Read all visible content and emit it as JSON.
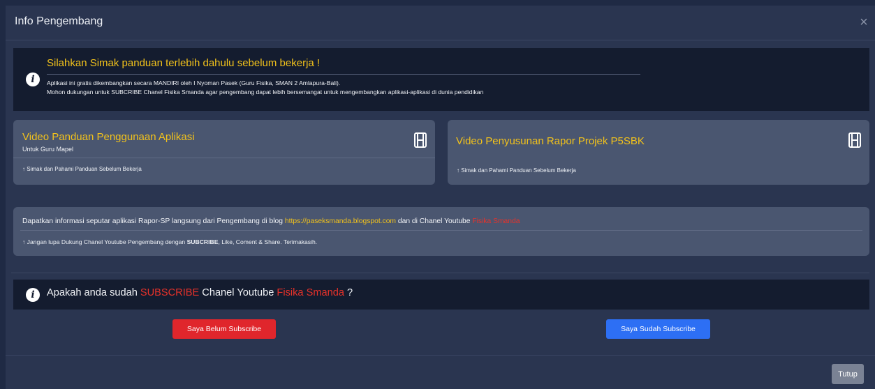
{
  "modal": {
    "title": "Info Pengembang",
    "close_icon": "×"
  },
  "notice": {
    "heading": "Silahkan Simak panduan terlebih dahulu sebelum bekerja !",
    "line1": "Aplikasi ini gratis dikembangkan secara MANDIRI oleh I Nyoman Pasek (Guru Fisika, SMAN 2 Amlapura-Bali).",
    "line2": "Mohon dukungan untuk SUBCRIBE Chanel Fisika Smanda agar pengembang dapat lebih bersemangat untuk mengembangkan aplikasi-aplikasi di dunia pendidikan",
    "icon": "info-circle-icon"
  },
  "cards": [
    {
      "title": "Video Panduan Penggunaan Aplikasi",
      "subtitle": "Untuk Guru Mapel",
      "footer": "↑ Simak dan Pahami Panduan Sebelum Bekerja",
      "icon": "film-icon"
    },
    {
      "title": "Video Penyusunan Rapor Projek P5SBK",
      "footer": "↑ Simak dan Pahami Panduan Sebelum Bekerja",
      "icon": "film-icon"
    }
  ],
  "info_panel": {
    "text_before_link": "Dapatkan informasi seputar aplikasi Rapor-SP langsung dari Pengembang di blog ",
    "blog_link": "https://paseksmanda.blogspot.com",
    "text_between": " dan di Chanel Youtube ",
    "channel_link": "Fisika Smanda",
    "footer_before": "↑ Jangan lupa Dukung Chanel Youtube Pengembang dengan ",
    "footer_bold": "SUBCRIBE",
    "footer_after": ", Like, Coment & Share. Terimakasih."
  },
  "question": {
    "part1": "Apakah anda sudah ",
    "subscribe": "SUBSCRIBE",
    "part2": " Chanel Youtube ",
    "channel": "Fisika Smanda",
    "part3": " ?",
    "icon": "info-circle-icon"
  },
  "buttons": {
    "not_subscribed": "Saya Belum Subscribe",
    "subscribed": "Saya Sudah Subscribe",
    "close": "Tutup"
  },
  "colors": {
    "accent_yellow": "#f2c21b",
    "danger_red": "#e0262c",
    "primary_blue": "#2d6ff4",
    "link_red": "#e8322a"
  }
}
